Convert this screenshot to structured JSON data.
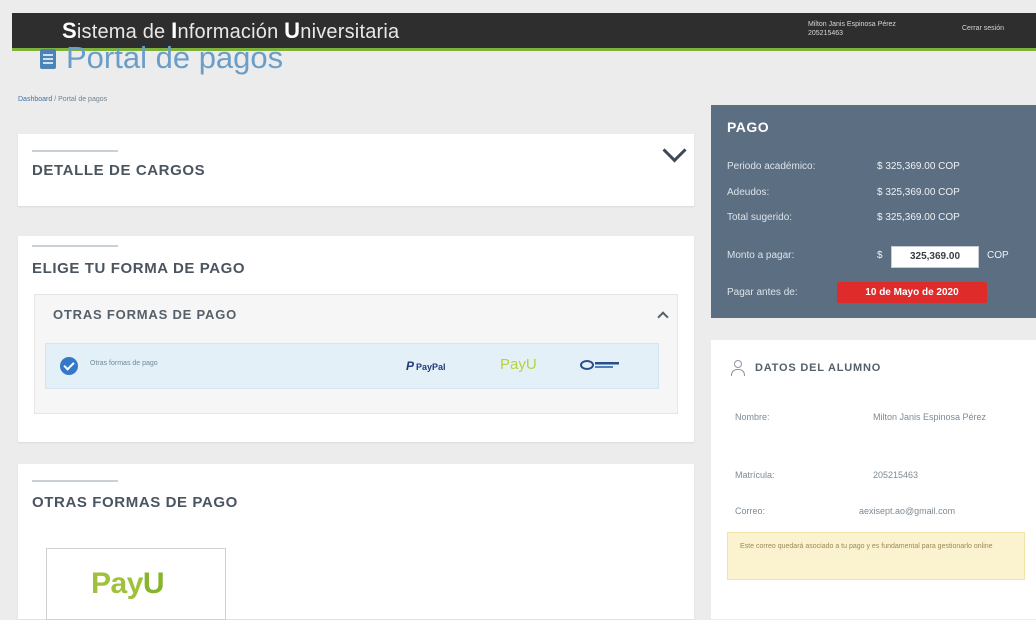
{
  "header": {
    "brand": {
      "p1": "S",
      "p2": "istema de ",
      "p3": "I",
      "p4": "nformación ",
      "p5": "U",
      "p6": "niversitaria"
    },
    "user_name": "Milton Janis Espinosa Pérez 205215463",
    "logout": "Cerrar sesión"
  },
  "page": {
    "title": "Portal de pagos",
    "breadcrumb_home": "Dashboard",
    "breadcrumb_sep": " / ",
    "breadcrumb_current": "Portal de pagos"
  },
  "detalle": {
    "title": "DETALLE DE CARGOS"
  },
  "forma_pago": {
    "title": "ELIGE TU FORMA DE PAGO",
    "sub_title": "OTRAS FORMAS DE PAGO",
    "option_label": "Otras formas de pago",
    "logos": {
      "paypal_mark": "P",
      "paypal": "PayPal",
      "payu": "PayU"
    }
  },
  "otras": {
    "title": "OTRAS FORMAS DE PAGO",
    "logo_pay": "Pay",
    "logo_u": "U"
  },
  "pago": {
    "title": "PAGO",
    "rows": [
      {
        "label": "Periodo académico:",
        "value": "$ 325,369.00 COP"
      },
      {
        "label": "Adeudos:",
        "value": "$ 325,369.00 COP"
      },
      {
        "label": "Total sugerido:",
        "value": "$ 325,369.00 COP"
      }
    ],
    "monto_label": "Monto a pagar:",
    "currency_symbol": "$",
    "monto_value": "325,369.00",
    "currency": "COP",
    "due_label": "Pagar antes de:",
    "due_date": "10 de Mayo de 2020",
    "colors": {
      "panel": "#5c6e82",
      "badge": "#e02b2b"
    }
  },
  "alumno": {
    "title": "DATOS DEL ALUMNO",
    "nombre_label": "Nombre:",
    "nombre_value": "Milton Janis Espinosa Pérez",
    "matricula_label": "Matrícula:",
    "matricula_value": "205215463",
    "correo_label": "Correo:",
    "correo_value": "aexisept.ao@gmail.com",
    "note": "Este correo quedará asociado a tu pago y es fundamental para gestionarlo online"
  }
}
